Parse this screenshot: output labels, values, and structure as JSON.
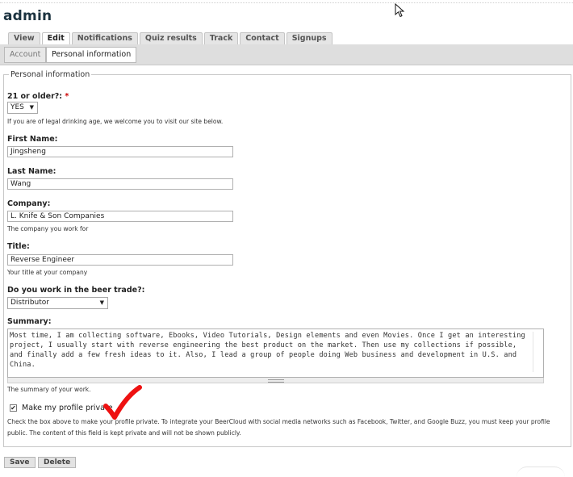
{
  "page": {
    "title": "admin"
  },
  "tabs_primary": [
    {
      "label": "View",
      "active": false
    },
    {
      "label": "Edit",
      "active": true
    },
    {
      "label": "Notifications",
      "active": false
    },
    {
      "label": "Quiz results",
      "active": false
    },
    {
      "label": "Track",
      "active": false
    },
    {
      "label": "Contact",
      "active": false
    },
    {
      "label": "Signups",
      "active": false
    }
  ],
  "tabs_secondary": [
    {
      "label": "Account",
      "active": false
    },
    {
      "label": "Personal information",
      "active": true
    }
  ],
  "form": {
    "legend": "Personal information",
    "age": {
      "label": "21 or older?:",
      "required_marker": "*",
      "value": "YES",
      "description": "If you are of legal drinking age, we welcome you to visit our site below."
    },
    "first_name": {
      "label": "First Name:",
      "value": "Jingsheng"
    },
    "last_name": {
      "label": "Last Name:",
      "value": "Wang"
    },
    "company": {
      "label": "Company:",
      "value": "L. Knife & Son Companies",
      "description": "The company you work for"
    },
    "title": {
      "label": "Title:",
      "value": "Reverse Engineer",
      "description": "Your title at your company"
    },
    "beer_trade": {
      "label": "Do you work in the beer trade?:",
      "value": "Distributor"
    },
    "summary": {
      "label": "Summary:",
      "value": "Most time, I am collecting software, Ebooks, Video Tutorials, Design elements and even Movies. Once I get an interesting project, I usually start with reverse engineering the best product on the market. Then use my collections if possible, and finally add a few fresh ideas to it. Also, I lead a group of people doing Web business and development in U.S. and China.",
      "description": "The summary of your work."
    },
    "private": {
      "label": "Make my profile private",
      "checked": true,
      "description": "Check the box above to make your profile private. To integrate your BeerCloud with social media networks such as Facebook, Twitter, and Google Buzz, you must keep your profile public. The content of this field is kept private and will not be shown publicly."
    }
  },
  "actions": {
    "save_label": "Save",
    "delete_label": "Delete"
  },
  "colors": {
    "title": "#1c3340",
    "required": "#cc0000",
    "annotation_check": "#ee1111",
    "tab_bar": "#dedede"
  },
  "icons": {
    "cursor": "mouse-pointer-icon",
    "annotation": "red-checkmark-icon",
    "dropdown": "caret-down-icon"
  }
}
